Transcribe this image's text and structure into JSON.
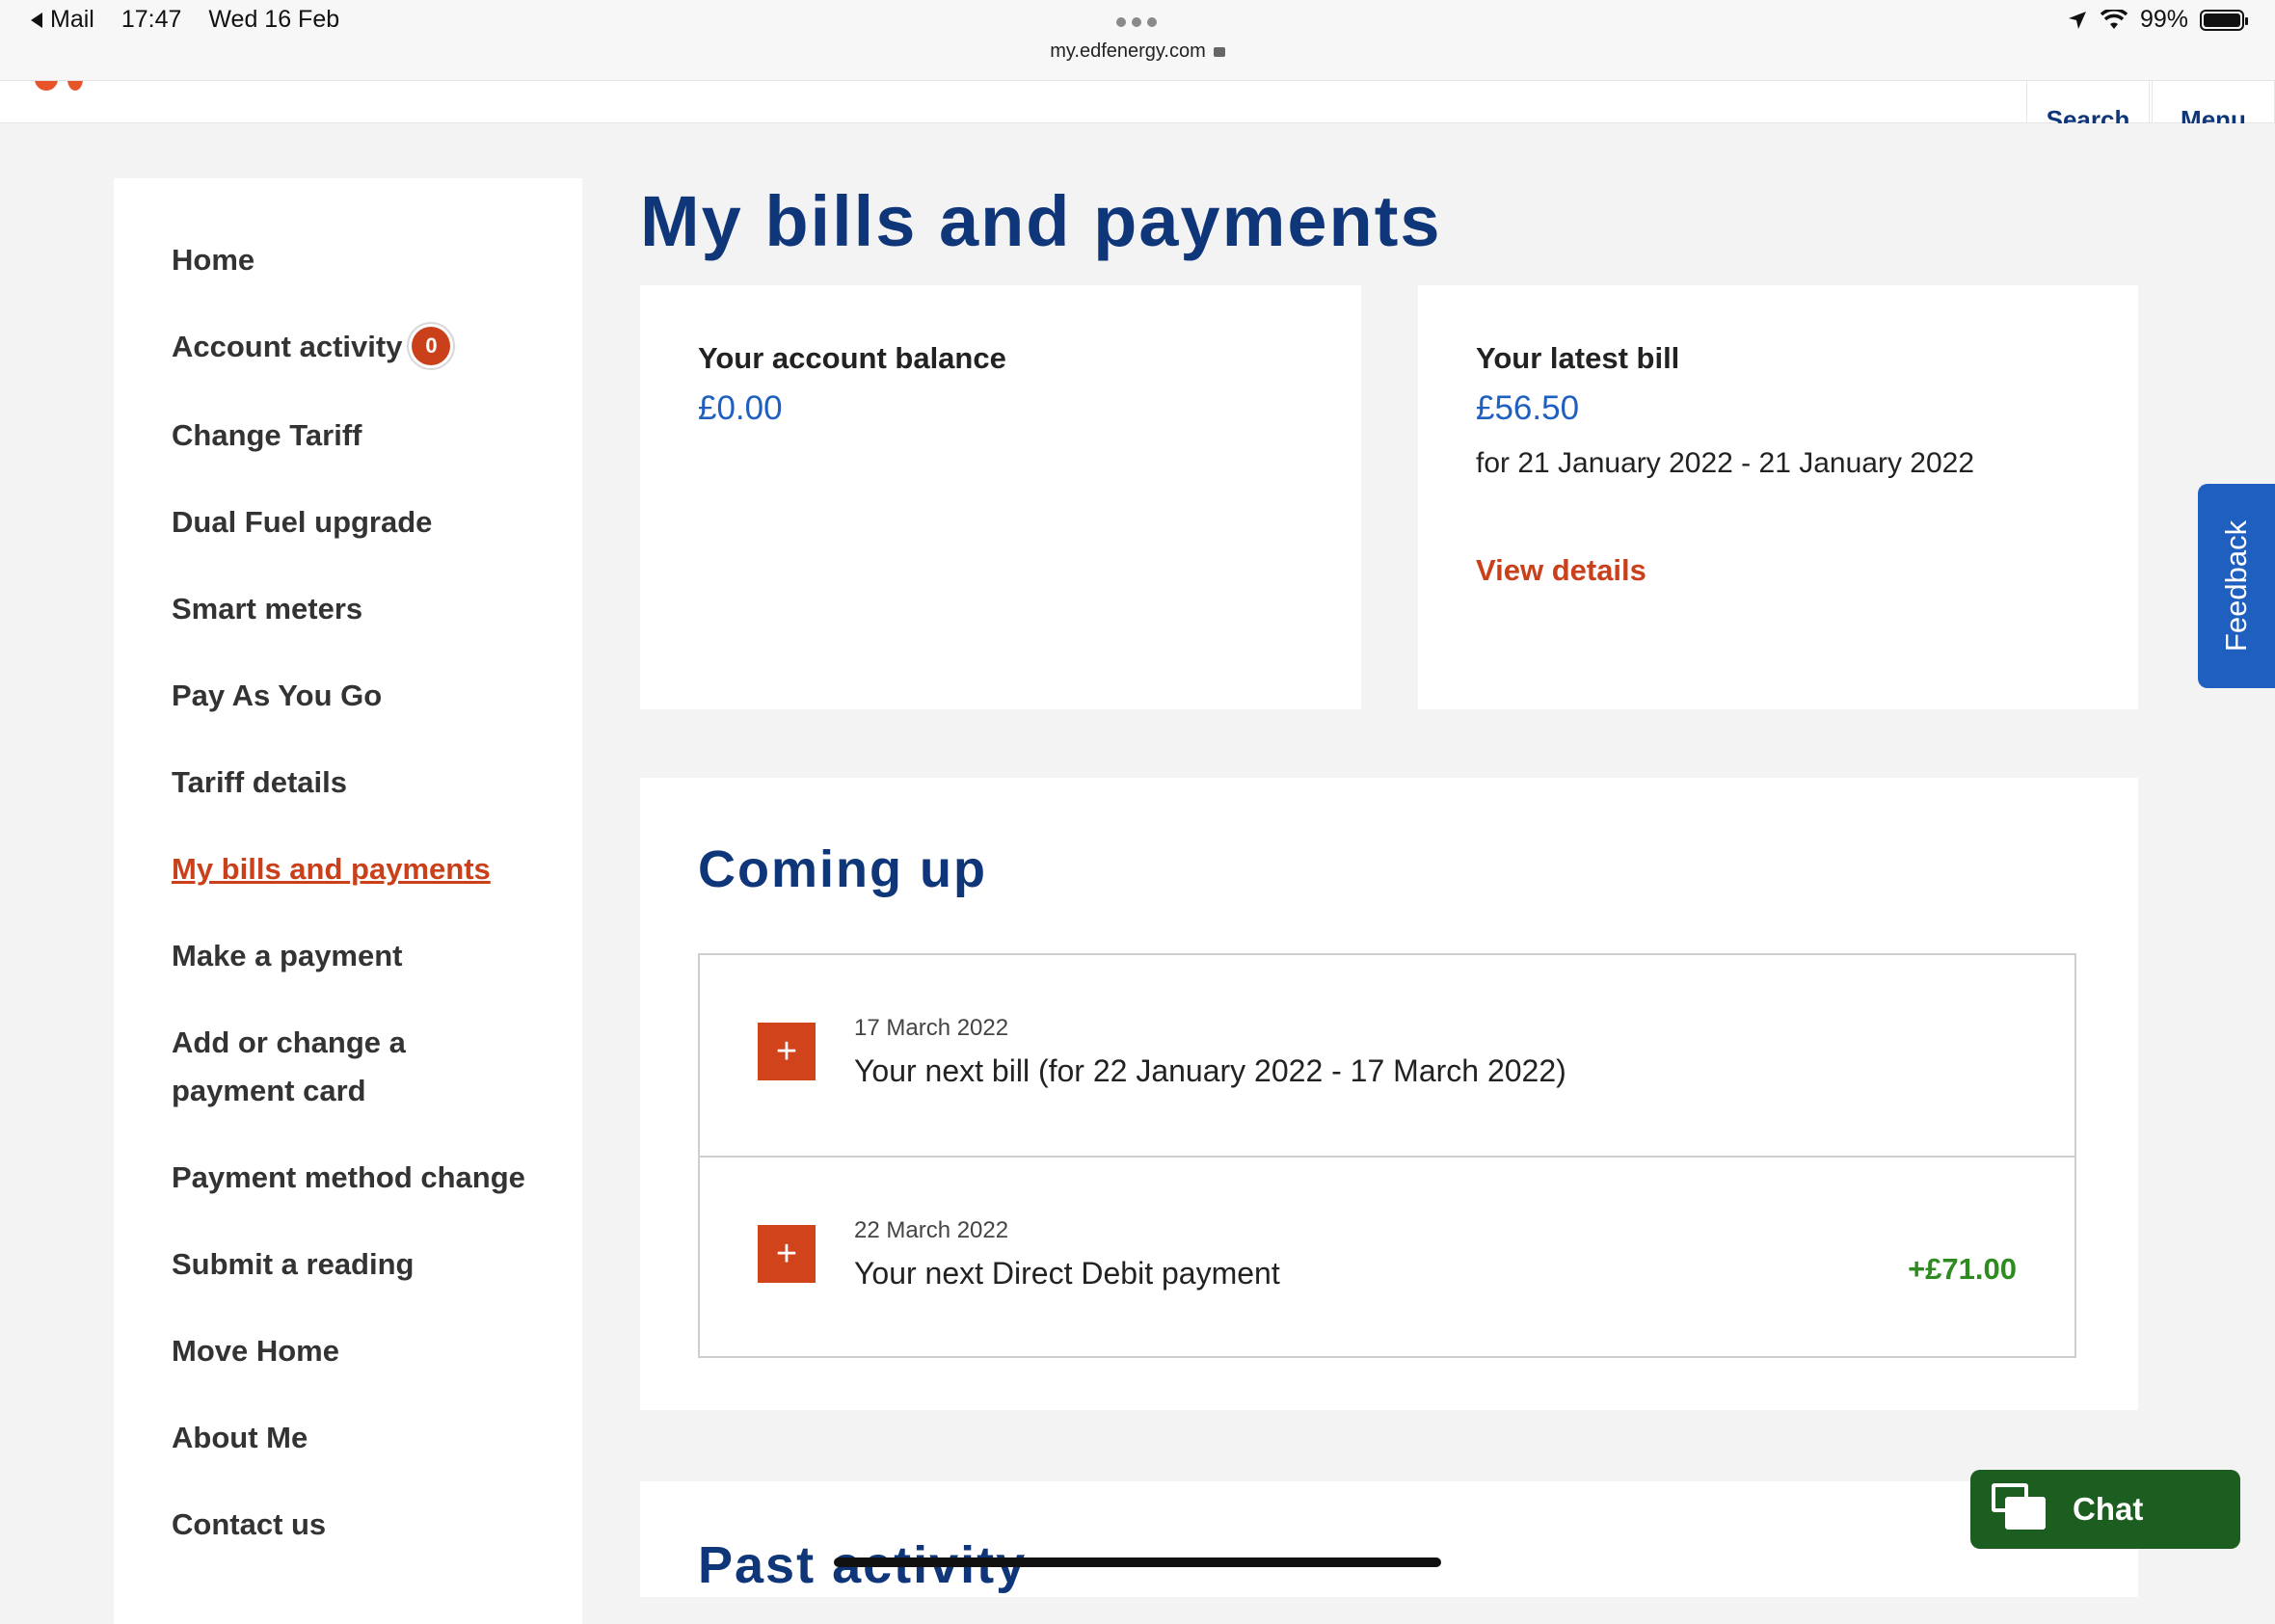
{
  "status_bar": {
    "back_app": "Mail",
    "time": "17:47",
    "date": "Wed 16 Feb",
    "url": "my.edfenergy.com",
    "battery": "99%"
  },
  "header": {
    "search_label": "Search",
    "menu_label": "Menu"
  },
  "sidebar": {
    "items": [
      {
        "label": "Home"
      },
      {
        "label": "Account activity",
        "badge": "0"
      },
      {
        "label": "Change Tariff"
      },
      {
        "label": "Dual Fuel upgrade"
      },
      {
        "label": "Smart meters"
      },
      {
        "label": "Pay As You Go"
      },
      {
        "label": "Tariff details"
      },
      {
        "label": "My bills and payments",
        "active": true
      },
      {
        "label": "Make a payment"
      },
      {
        "label": "Add or change a",
        "label2": "payment card"
      },
      {
        "label": "Payment method change"
      },
      {
        "label": "Submit a reading"
      },
      {
        "label": "Move Home"
      },
      {
        "label": "About Me"
      },
      {
        "label": "Contact us"
      }
    ]
  },
  "main": {
    "title": "My bills and payments",
    "balance": {
      "label": "Your account balance",
      "value": "£0.00"
    },
    "latest_bill": {
      "label": "Your latest bill",
      "value": "£56.50",
      "period": "for 21 January 2022 - 21 January 2022",
      "link": "View details"
    },
    "coming_up": {
      "title": "Coming up",
      "items": [
        {
          "date": "17 March 2022",
          "description": "Your next bill (for 22 January 2022 - 17 March 2022)",
          "amount": ""
        },
        {
          "date": "22 March 2022",
          "description": "Your next Direct Debit payment",
          "amount": "+£71.00"
        }
      ]
    },
    "past_activity": {
      "title": "Past activity"
    }
  },
  "feedback_label": "Feedback",
  "chat_label": "Chat",
  "colors": {
    "brand_blue": "#10367a",
    "link_orange": "#c9401b",
    "value_blue": "#1f5fbf",
    "positive_green": "#2e8b1f",
    "chat_green": "#1b5e20"
  }
}
